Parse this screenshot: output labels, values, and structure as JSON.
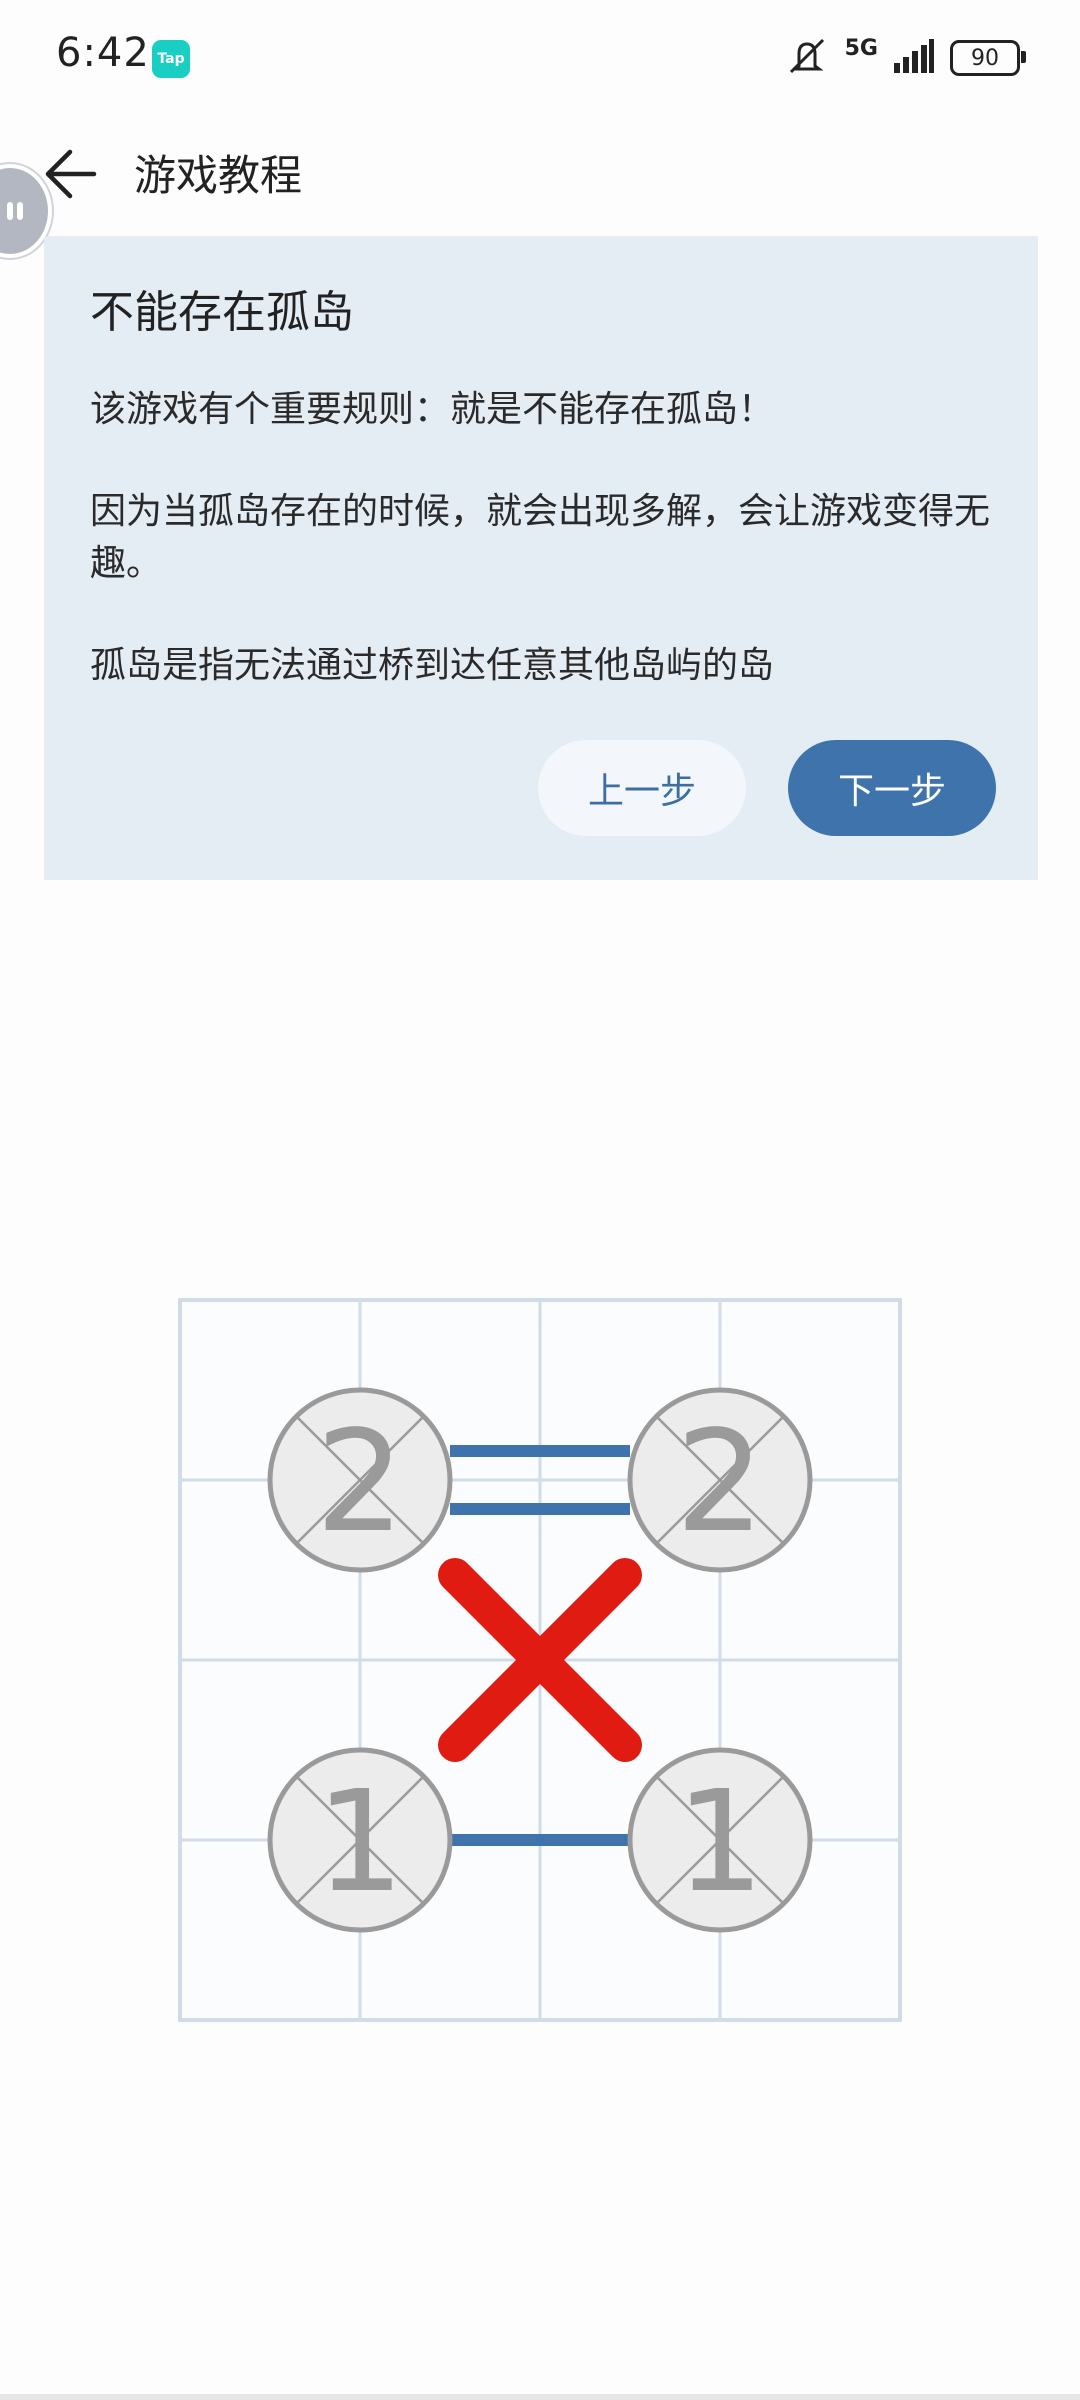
{
  "status_bar": {
    "time": "6:42",
    "app_badge": "Tap",
    "network": "5G",
    "battery": "90",
    "icons": [
      "mute-icon",
      "signal-icon",
      "battery-icon"
    ]
  },
  "header": {
    "back_icon": "arrow-left-icon",
    "title": "游戏教程"
  },
  "card": {
    "title": "不能存在孤岛",
    "paragraphs": [
      "该游戏有个重要规则：就是不能存在孤岛！",
      "因为当孤岛存在的时候，就会出现多解，会让游戏变得无趣。",
      "孤岛是指无法通过桥到达任意其他岛屿的岛"
    ],
    "prev_label": "上一步",
    "next_label": "下一步"
  },
  "board": {
    "grid_cols": 4,
    "grid_rows": 4,
    "islands": [
      {
        "label": "2",
        "row": 1,
        "col": 1
      },
      {
        "label": "2",
        "row": 1,
        "col": 3
      },
      {
        "label": "1",
        "row": 3,
        "col": 1
      },
      {
        "label": "1",
        "row": 3,
        "col": 3
      }
    ],
    "bridges": [
      {
        "from": 0,
        "to": 1,
        "count": 2
      },
      {
        "from": 2,
        "to": 3,
        "count": 1
      }
    ],
    "invalid_mark": "x-mark-icon",
    "colors": {
      "grid": "#d2dce8",
      "bridge": "#3e74ab",
      "island_fill": "#ececec",
      "island_stroke": "#9a9a9a",
      "x_mark": "#e01b12"
    }
  }
}
